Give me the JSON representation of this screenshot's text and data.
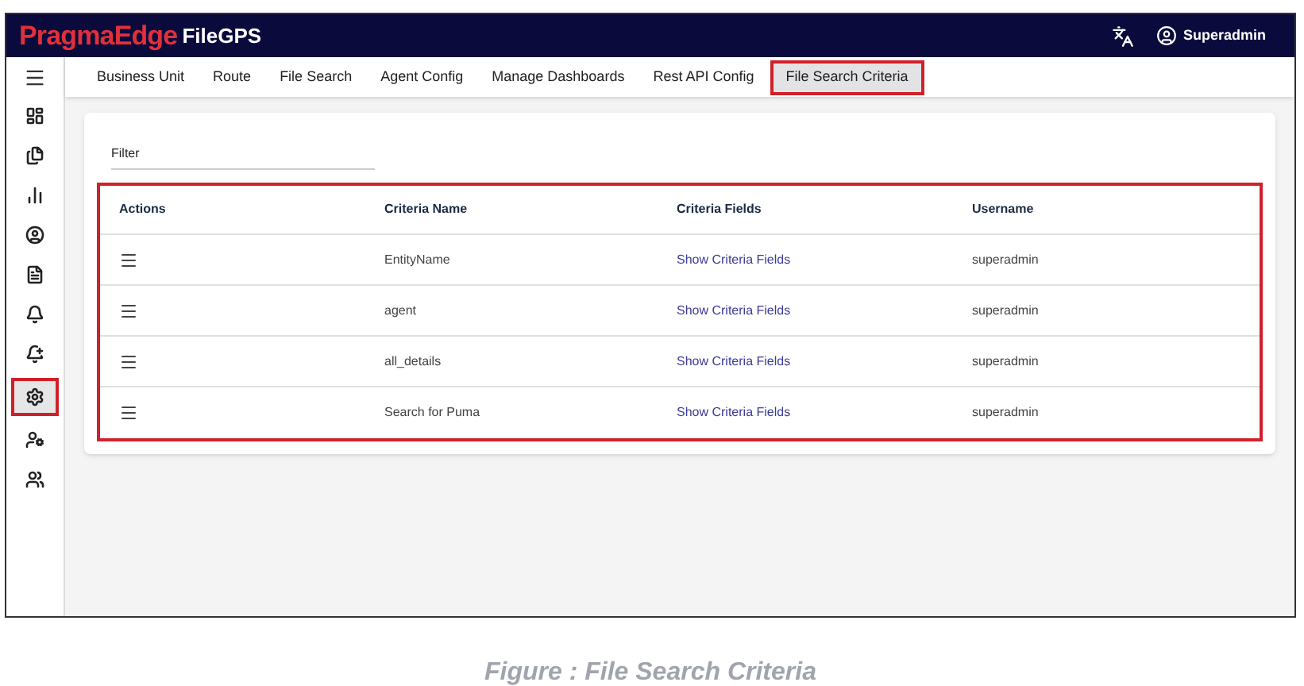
{
  "header": {
    "brand": "PragmaEdge",
    "product": "FileGPS",
    "user": "Superadmin"
  },
  "tabs": [
    {
      "label": "Business Unit",
      "selected": false
    },
    {
      "label": "Route",
      "selected": false
    },
    {
      "label": "File Search",
      "selected": false
    },
    {
      "label": "Agent Config",
      "selected": false
    },
    {
      "label": "Manage Dashboards",
      "selected": false
    },
    {
      "label": "Rest API Config",
      "selected": false
    },
    {
      "label": "File Search Criteria",
      "selected": true
    }
  ],
  "sidebar": {
    "items": [
      {
        "selected": false
      },
      {
        "selected": false
      },
      {
        "selected": false
      },
      {
        "selected": false
      },
      {
        "selected": false
      },
      {
        "selected": false
      },
      {
        "selected": false
      },
      {
        "selected": true
      },
      {
        "selected": false
      },
      {
        "selected": false
      }
    ]
  },
  "filter": {
    "placeholder": "Filter"
  },
  "table": {
    "highlighted": true,
    "columns": [
      "Actions",
      "Criteria Name",
      "Criteria Fields",
      "Username"
    ],
    "rows": [
      {
        "criteria_name": "EntityName",
        "criteria_fields": "Show Criteria Fields",
        "username": "superadmin"
      },
      {
        "criteria_name": "agent",
        "criteria_fields": "Show Criteria Fields",
        "username": "superadmin"
      },
      {
        "criteria_name": "all_details",
        "criteria_fields": "Show Criteria Fields",
        "username": "superadmin"
      },
      {
        "criteria_name": "Search for Puma",
        "criteria_fields": "Show Criteria Fields",
        "username": "superadmin"
      }
    ]
  },
  "caption": "Figure : File Search Criteria"
}
